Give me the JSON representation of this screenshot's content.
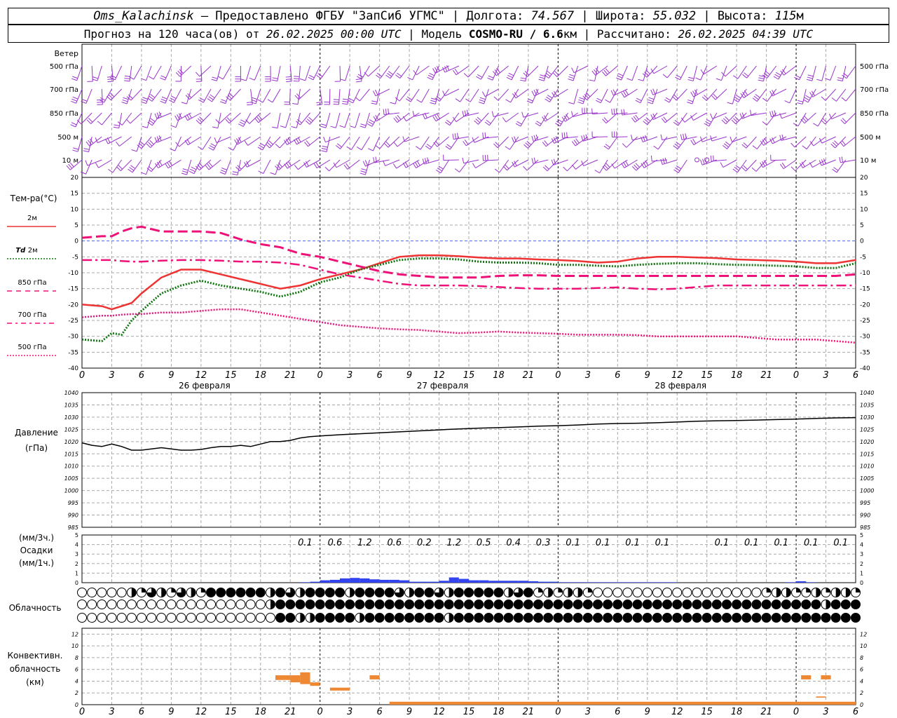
{
  "header": {
    "station": "Oms_Kalachinsk",
    "provided_by": "— Предоставлено ФГБУ \"ЗапСиб УГМС\"",
    "lon_label": "Долгота:",
    "lon_value": "74.567",
    "lat_label": "Широта:",
    "lat_value": "55.032",
    "alt_label": "Высота:",
    "alt_value": "115",
    "alt_unit": "м",
    "forecast_text": "Прогноз на 120 часа(ов) от",
    "forecast_start": "26.02.2025 00:00 UTC",
    "model_label": "Модель",
    "model_name": "COSMO-RU / 6.6",
    "model_unit": "км",
    "computed_label": "Рассчитано:",
    "computed_value": "26.02.2025 04:39 UTC"
  },
  "axes": {
    "hour_ticks": [
      "0",
      "3",
      "6",
      "9",
      "12",
      "15",
      "18",
      "21",
      "0",
      "3",
      "6",
      "9",
      "12",
      "15",
      "18",
      "21",
      "0",
      "3",
      "6",
      "9",
      "12",
      "15",
      "18",
      "21",
      "0",
      "3",
      "6"
    ],
    "day_labels": [
      "26 февраля",
      "27 февраля",
      "28 февраля"
    ]
  },
  "wind_panel": {
    "title": "Ветер",
    "levels": [
      "500 гПа",
      "700 гПа",
      "850 гПа",
      "500 м",
      "10 м"
    ],
    "color": "#9933cc"
  },
  "temp_panel": {
    "title": "Тем-ра(°C)",
    "ylim": [
      -40,
      20
    ],
    "ticks": [
      "20",
      "15",
      "10",
      "5",
      "0",
      "-5",
      "-10",
      "-15",
      "-20",
      "-25",
      "-30",
      "-35",
      "-40"
    ],
    "legend": [
      {
        "label": "2м",
        "color": "#ee3333"
      },
      {
        "label_prefix": "Td",
        "label": "2м",
        "color": "#117711"
      },
      {
        "label": "850 гПа",
        "color": "#ee1177"
      },
      {
        "label": "700 гПа",
        "color": "#ee1177"
      },
      {
        "label": "500 гПа",
        "color": "#ee1177"
      }
    ]
  },
  "pressure_panel": {
    "title": "Давление",
    "unit": "(гПа)",
    "ylim": [
      985,
      1040
    ],
    "ticks": [
      "1040",
      "1035",
      "1030",
      "1025",
      "1020",
      "1015",
      "1010",
      "1005",
      "1000",
      "995",
      "990",
      "985"
    ]
  },
  "precip_panel": {
    "title_line1": "(мм/3ч.)",
    "title_line2": "Осадки",
    "title_line3": "(мм/1ч.)",
    "ticks": [
      "5",
      "4",
      "3",
      "2",
      "1",
      "0"
    ],
    "amounts_3h": [
      {
        "t": 22.5,
        "v": "0.1"
      },
      {
        "t": 25.5,
        "v": "0.6"
      },
      {
        "t": 28.5,
        "v": "1.2"
      },
      {
        "t": 31.5,
        "v": "0.6"
      },
      {
        "t": 34.5,
        "v": "0.2"
      },
      {
        "t": 37.5,
        "v": "1.2"
      },
      {
        "t": 40.5,
        "v": "0.5"
      },
      {
        "t": 43.5,
        "v": "0.4"
      },
      {
        "t": 46.5,
        "v": "0.3"
      },
      {
        "t": 49.5,
        "v": "0.1"
      },
      {
        "t": 52.5,
        "v": "0.1"
      },
      {
        "t": 55.5,
        "v": "0.1"
      },
      {
        "t": 58.5,
        "v": "0.1"
      },
      {
        "t": 64.5,
        "v": "0.1"
      },
      {
        "t": 67.5,
        "v": "0.1"
      },
      {
        "t": 70.5,
        "v": "0.1"
      },
      {
        "t": 73.5,
        "v": "0.1"
      },
      {
        "t": 76.5,
        "v": "0.1"
      }
    ],
    "color": "#3344ee"
  },
  "cloud_panel": {
    "title": "Облачность",
    "rows": 3
  },
  "conv_panel": {
    "title_line1": "Конвективн.",
    "title_line2": "облачность",
    "title_line3": "(км)",
    "ticks": [
      "12",
      "10",
      "8",
      "6",
      "4",
      "2",
      "0"
    ],
    "ylim": [
      0,
      13
    ],
    "color": "#ee8833"
  },
  "chart_data": [
    {
      "type": "line",
      "title": "Тем-ра(°C)",
      "x_unit": "hours since 26.02.2025 00:00 UTC",
      "ylim": [
        -40,
        20
      ],
      "grid": true,
      "series": [
        {
          "name": "2м",
          "x": [
            0,
            2,
            3,
            5,
            6,
            8,
            10,
            12,
            14,
            16,
            18,
            20,
            22,
            24,
            26,
            28,
            30,
            32,
            34,
            36,
            38,
            40,
            42,
            44,
            46,
            48,
            50,
            52,
            54,
            56,
            58,
            60,
            62,
            64,
            66,
            68,
            70,
            72,
            74,
            76,
            78
          ],
          "values": [
            -20,
            -20.5,
            -21.5,
            -19.5,
            -16.5,
            -11.5,
            -9,
            -9,
            -10.5,
            -12,
            -13.5,
            -15,
            -14,
            -12,
            -10.5,
            -9,
            -7,
            -5,
            -4.5,
            -4.5,
            -4.8,
            -5.2,
            -5.5,
            -5.5,
            -5.8,
            -6,
            -6.3,
            -6.8,
            -6.5,
            -5.5,
            -5,
            -5,
            -5.2,
            -5.4,
            -5.8,
            -6,
            -6.2,
            -6.5,
            -7,
            -7,
            -6
          ]
        },
        {
          "name": "Td 2м",
          "x": [
            0,
            2,
            3,
            4,
            5,
            6,
            8,
            10,
            12,
            14,
            16,
            18,
            20,
            22,
            24,
            26,
            28,
            30,
            32,
            34,
            36,
            38,
            40,
            42,
            44,
            46,
            48,
            50,
            52,
            54,
            56,
            58,
            60,
            62,
            64,
            66,
            68,
            70,
            72,
            74,
            76,
            78
          ],
          "values": [
            -31,
            -31.5,
            -29,
            -29.5,
            -25,
            -22,
            -16.5,
            -14,
            -12.5,
            -14,
            -15,
            -16,
            -17.5,
            -16,
            -13,
            -11.5,
            -9,
            -7.5,
            -6,
            -5.5,
            -5.5,
            -5.8,
            -6.5,
            -6.8,
            -6.8,
            -7,
            -7.5,
            -7.5,
            -7.8,
            -8,
            -7.5,
            -7.2,
            -7,
            -7,
            -7.3,
            -7.5,
            -7.6,
            -7.8,
            -8,
            -8.5,
            -8.5,
            -7
          ]
        },
        {
          "name": "850 гПа",
          "x": [
            0,
            2,
            3,
            4,
            5,
            6,
            8,
            10,
            12,
            14,
            16,
            18,
            20,
            22,
            24,
            26,
            28,
            30,
            32,
            34,
            36,
            38,
            40,
            42,
            44,
            46,
            48,
            50,
            52,
            54,
            56,
            58,
            60,
            62,
            64,
            66,
            68,
            70,
            72,
            74,
            76,
            78
          ],
          "values": [
            1,
            1.5,
            1.5,
            3,
            4,
            4.5,
            3,
            3,
            3,
            2.5,
            0.5,
            -1,
            -2,
            -4,
            -5,
            -6.5,
            -8,
            -9.5,
            -10.5,
            -11,
            -11.5,
            -11.5,
            -11.5,
            -11,
            -10.8,
            -10.8,
            -11,
            -11,
            -11,
            -11,
            -11,
            -11,
            -11,
            -11,
            -11,
            -11,
            -11,
            -11,
            -11,
            -11,
            -11,
            -10.5
          ]
        },
        {
          "name": "700 гПа",
          "x": [
            0,
            2,
            3,
            4,
            5,
            6,
            8,
            10,
            12,
            14,
            16,
            18,
            20,
            22,
            24,
            26,
            28,
            30,
            32,
            34,
            36,
            38,
            40,
            42,
            44,
            46,
            48,
            50,
            52,
            54,
            56,
            58,
            60,
            62,
            64,
            66,
            68,
            70,
            72,
            74,
            76,
            78
          ],
          "values": [
            -6,
            -6,
            -6,
            -6.3,
            -6.5,
            -6.5,
            -6.2,
            -6,
            -6,
            -6.2,
            -6.5,
            -6.5,
            -6.8,
            -7.5,
            -9,
            -10.5,
            -11.5,
            -12.5,
            -13.5,
            -14,
            -14,
            -14,
            -14.2,
            -14.5,
            -14.8,
            -15,
            -15,
            -15,
            -14.8,
            -14.6,
            -15,
            -15.2,
            -15,
            -14.5,
            -14,
            -14,
            -14,
            -14,
            -14,
            -14,
            -14,
            -14
          ]
        },
        {
          "name": "500 гПа",
          "x": [
            0,
            2,
            3,
            4,
            5,
            6,
            8,
            10,
            12,
            14,
            16,
            18,
            20,
            22,
            24,
            26,
            28,
            30,
            32,
            34,
            36,
            38,
            40,
            42,
            44,
            46,
            48,
            50,
            52,
            54,
            56,
            58,
            60,
            62,
            64,
            66,
            68,
            70,
            72,
            74,
            76,
            78
          ],
          "values": [
            -24,
            -23.5,
            -23.5,
            -23.2,
            -23,
            -23,
            -22.5,
            -22.5,
            -22,
            -21.5,
            -21.5,
            -22.5,
            -23.5,
            -24.5,
            -25.5,
            -26.5,
            -27,
            -27.5,
            -27.8,
            -28,
            -28.5,
            -29,
            -28.8,
            -28.5,
            -28.8,
            -29,
            -29.2,
            -29.5,
            -29.5,
            -29.5,
            -29.6,
            -30,
            -30,
            -30,
            -30,
            -30,
            -30.5,
            -31,
            -31,
            -31,
            -31.5,
            -32
          ]
        }
      ]
    },
    {
      "type": "line",
      "title": "Давление",
      "x_unit": "hours since 26.02.2025 00:00 UTC",
      "ylim": [
        985,
        1040
      ],
      "grid": true,
      "series": [
        {
          "name": "Давление",
          "x": [
            0,
            1,
            2,
            3,
            4,
            5,
            6,
            7,
            8,
            9,
            10,
            11,
            12,
            13,
            14,
            15,
            16,
            17,
            18,
            19,
            20,
            21,
            22,
            23,
            24,
            26,
            28,
            30,
            32,
            34,
            36,
            38,
            40,
            42,
            44,
            46,
            48,
            50,
            52,
            54,
            56,
            58,
            60,
            62,
            64,
            66,
            68,
            70,
            72,
            74,
            76,
            78
          ],
          "values": [
            1019.5,
            1018.5,
            1018,
            1019,
            1018,
            1016.5,
            1016.5,
            1017,
            1017.5,
            1017,
            1016.5,
            1016.5,
            1016.8,
            1017.5,
            1018,
            1018,
            1018.5,
            1018,
            1019,
            1020,
            1020,
            1020.5,
            1021.5,
            1022,
            1022.3,
            1022.8,
            1023.2,
            1023.6,
            1024,
            1024.4,
            1024.8,
            1025.2,
            1025.5,
            1025.7,
            1026,
            1026.3,
            1026.5,
            1026.8,
            1027.2,
            1027.4,
            1027.5,
            1027.7,
            1028,
            1028.3,
            1028.5,
            1028.6,
            1028.8,
            1029,
            1029.2,
            1029.5,
            1029.7,
            1029.8
          ]
        }
      ]
    },
    {
      "type": "bar",
      "title": "Осадки",
      "x_unit": "hours since 26.02.2025 00:00 UTC",
      "series": [
        {
          "name": "мм/1ч",
          "x": [
            23,
            24,
            25,
            26,
            27,
            28,
            29,
            30,
            31,
            32,
            33,
            34,
            35,
            36,
            37,
            38,
            39,
            40,
            41,
            42,
            43,
            44,
            45,
            46,
            47,
            48,
            49,
            50,
            51,
            52,
            53,
            54,
            55,
            56,
            57,
            58,
            59,
            60,
            72,
            73,
            74
          ],
          "values": [
            0.05,
            0.1,
            0.25,
            0.3,
            0.45,
            0.5,
            0.45,
            0.35,
            0.3,
            0.3,
            0.25,
            0.1,
            0.1,
            0.1,
            0.2,
            0.55,
            0.4,
            0.25,
            0.25,
            0.2,
            0.2,
            0.2,
            0.2,
            0.15,
            0.1,
            0.1,
            0.05,
            0.05,
            0.05,
            0.05,
            0.05,
            0.05,
            0.05,
            0.05,
            0.05,
            0.05,
            0.05,
            0.05,
            0.05,
            0.15,
            0.05
          ]
        }
      ]
    },
    {
      "type": "bar",
      "title": "Конвективн. облачность (км)",
      "x_unit": "hours since 26.02.2025 00:00 UTC",
      "ylim": [
        0,
        13
      ],
      "series": [
        {
          "name": "convective",
          "ranges": [
            {
              "t0": 19.5,
              "t1": 21,
              "lo": 4.2,
              "hi": 5
            },
            {
              "t0": 21,
              "t1": 22,
              "lo": 3.8,
              "hi": 5
            },
            {
              "t0": 22,
              "t1": 23,
              "lo": 3.5,
              "hi": 5.5
            },
            {
              "t0": 23,
              "t1": 24,
              "lo": 3.2,
              "hi": 3.8
            },
            {
              "t0": 25,
              "t1": 27,
              "lo": 2.4,
              "hi": 2.9
            },
            {
              "t0": 29,
              "t1": 30,
              "lo": 4.3,
              "hi": 5
            },
            {
              "t0": 31,
              "t1": 78,
              "lo": 0,
              "hi": 0.5
            },
            {
              "t0": 72.5,
              "t1": 73.5,
              "lo": 4.3,
              "hi": 5
            },
            {
              "t0": 74.5,
              "t1": 75.5,
              "lo": 4.3,
              "hi": 5
            },
            {
              "t0": 74,
              "t1": 75,
              "lo": 1.2,
              "hi": 1.4
            }
          ]
        }
      ]
    }
  ]
}
